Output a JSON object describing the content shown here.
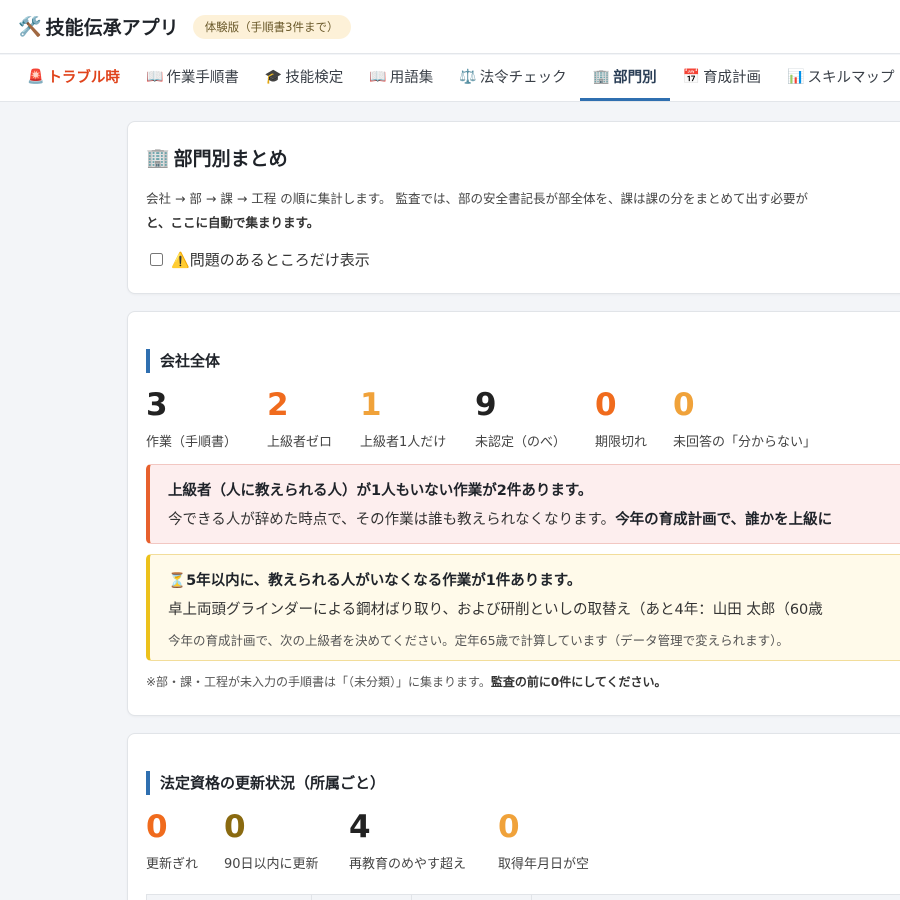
{
  "header": {
    "app_icon": "tools-icon",
    "title": "技能伝承アプリ",
    "trial_badge": "体験版（手順書3件まで）"
  },
  "nav": {
    "tabs": [
      {
        "icon": "🚨",
        "label": "トラブル時"
      },
      {
        "icon": "📖",
        "label": "作業手順書"
      },
      {
        "icon": "🎓",
        "label": "技能検定"
      },
      {
        "icon": "📖",
        "label": "用語集"
      },
      {
        "icon": "⚖️",
        "label": "法令チェック"
      },
      {
        "icon": "🏢",
        "label": "部門別"
      },
      {
        "icon": "📅",
        "label": "育成計画"
      },
      {
        "icon": "📊",
        "label": "スキルマップ"
      }
    ],
    "active": "部門別"
  },
  "summary_card": {
    "icon": "🏢",
    "title": "部門別まとめ",
    "desc_line1": "会社 → 部 → 課 → 工程 の順に集計します。 監査では、部の安全書記長が部全体を、課は課の分をまとめて出す必要が",
    "desc_line2": "と、ここに自動で集まります。",
    "filter_icon": "⚠️",
    "filter_label": "問題のあるところだけ表示"
  },
  "company": {
    "title": "会社全体",
    "stats": [
      {
        "value": "3",
        "label": "作業（手順書）"
      },
      {
        "value": "2",
        "label": "上級者ゼロ"
      },
      {
        "value": "1",
        "label": "上級者1人だけ"
      },
      {
        "value": "9",
        "label": "未認定（のべ）"
      },
      {
        "value": "0",
        "label": "期限切れ"
      },
      {
        "value": "0",
        "label": "未回答の「分からない」"
      }
    ],
    "alert_red": {
      "title": "上級者（人に教えられる人）が1人もいない作業が2件あります。",
      "text_normal": "今できる人が辞めた時点で、その作業は誰も教えられなくなります。",
      "text_bold": "今年の育成計画で、誰かを上級に"
    },
    "alert_yellow": {
      "icon": "⏳",
      "title": "5年以内に、教えられる人がいなくなる作業が1件あります。",
      "text": "卓上両頭グラインダーによる鋼材ばり取り、および研削といしの取替え（あと4年：山田 太郎（60歳",
      "note": "今年の育成計画で、次の上級者を決めてください。定年65歳で計算しています（データ管理で変えられます）。"
    },
    "footnote_normal": "※部・課・工程が未入力の手順書は「（未分類）」に集まります。",
    "footnote_bold": "監査の前に0件にしてください。"
  },
  "licenses": {
    "title": "法定資格の更新状況（所属ごと）",
    "stats": [
      {
        "value": "0",
        "label": "更新ぎれ"
      },
      {
        "value": "0",
        "label": "90日以内に更新"
      },
      {
        "value": "4",
        "label": "再教育のめやす超え"
      },
      {
        "value": "0",
        "label": "取得年月日が空"
      }
    ]
  },
  "colors": {
    "accent": "#2f6fb0",
    "orange": "#f06b1d",
    "amber": "#f0a23a",
    "olive": "#8a6a10",
    "alert_red_border": "#e7602d",
    "alert_yellow_border": "#ecc11b"
  }
}
